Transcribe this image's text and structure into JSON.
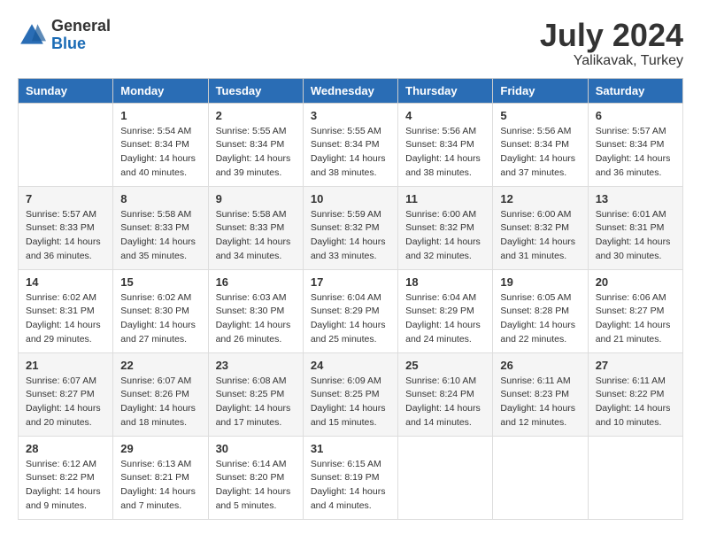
{
  "header": {
    "logo_general": "General",
    "logo_blue": "Blue",
    "title": "July 2024",
    "location": "Yalikavak, Turkey"
  },
  "days_of_week": [
    "Sunday",
    "Monday",
    "Tuesday",
    "Wednesday",
    "Thursday",
    "Friday",
    "Saturday"
  ],
  "weeks": [
    [
      {
        "day": "",
        "sunrise": "",
        "sunset": "",
        "daylight": ""
      },
      {
        "day": "1",
        "sunrise": "Sunrise: 5:54 AM",
        "sunset": "Sunset: 8:34 PM",
        "daylight": "Daylight: 14 hours and 40 minutes."
      },
      {
        "day": "2",
        "sunrise": "Sunrise: 5:55 AM",
        "sunset": "Sunset: 8:34 PM",
        "daylight": "Daylight: 14 hours and 39 minutes."
      },
      {
        "day": "3",
        "sunrise": "Sunrise: 5:55 AM",
        "sunset": "Sunset: 8:34 PM",
        "daylight": "Daylight: 14 hours and 38 minutes."
      },
      {
        "day": "4",
        "sunrise": "Sunrise: 5:56 AM",
        "sunset": "Sunset: 8:34 PM",
        "daylight": "Daylight: 14 hours and 38 minutes."
      },
      {
        "day": "5",
        "sunrise": "Sunrise: 5:56 AM",
        "sunset": "Sunset: 8:34 PM",
        "daylight": "Daylight: 14 hours and 37 minutes."
      },
      {
        "day": "6",
        "sunrise": "Sunrise: 5:57 AM",
        "sunset": "Sunset: 8:34 PM",
        "daylight": "Daylight: 14 hours and 36 minutes."
      }
    ],
    [
      {
        "day": "7",
        "sunrise": "Sunrise: 5:57 AM",
        "sunset": "Sunset: 8:33 PM",
        "daylight": "Daylight: 14 hours and 36 minutes."
      },
      {
        "day": "8",
        "sunrise": "Sunrise: 5:58 AM",
        "sunset": "Sunset: 8:33 PM",
        "daylight": "Daylight: 14 hours and 35 minutes."
      },
      {
        "day": "9",
        "sunrise": "Sunrise: 5:58 AM",
        "sunset": "Sunset: 8:33 PM",
        "daylight": "Daylight: 14 hours and 34 minutes."
      },
      {
        "day": "10",
        "sunrise": "Sunrise: 5:59 AM",
        "sunset": "Sunset: 8:32 PM",
        "daylight": "Daylight: 14 hours and 33 minutes."
      },
      {
        "day": "11",
        "sunrise": "Sunrise: 6:00 AM",
        "sunset": "Sunset: 8:32 PM",
        "daylight": "Daylight: 14 hours and 32 minutes."
      },
      {
        "day": "12",
        "sunrise": "Sunrise: 6:00 AM",
        "sunset": "Sunset: 8:32 PM",
        "daylight": "Daylight: 14 hours and 31 minutes."
      },
      {
        "day": "13",
        "sunrise": "Sunrise: 6:01 AM",
        "sunset": "Sunset: 8:31 PM",
        "daylight": "Daylight: 14 hours and 30 minutes."
      }
    ],
    [
      {
        "day": "14",
        "sunrise": "Sunrise: 6:02 AM",
        "sunset": "Sunset: 8:31 PM",
        "daylight": "Daylight: 14 hours and 29 minutes."
      },
      {
        "day": "15",
        "sunrise": "Sunrise: 6:02 AM",
        "sunset": "Sunset: 8:30 PM",
        "daylight": "Daylight: 14 hours and 27 minutes."
      },
      {
        "day": "16",
        "sunrise": "Sunrise: 6:03 AM",
        "sunset": "Sunset: 8:30 PM",
        "daylight": "Daylight: 14 hours and 26 minutes."
      },
      {
        "day": "17",
        "sunrise": "Sunrise: 6:04 AM",
        "sunset": "Sunset: 8:29 PM",
        "daylight": "Daylight: 14 hours and 25 minutes."
      },
      {
        "day": "18",
        "sunrise": "Sunrise: 6:04 AM",
        "sunset": "Sunset: 8:29 PM",
        "daylight": "Daylight: 14 hours and 24 minutes."
      },
      {
        "day": "19",
        "sunrise": "Sunrise: 6:05 AM",
        "sunset": "Sunset: 8:28 PM",
        "daylight": "Daylight: 14 hours and 22 minutes."
      },
      {
        "day": "20",
        "sunrise": "Sunrise: 6:06 AM",
        "sunset": "Sunset: 8:27 PM",
        "daylight": "Daylight: 14 hours and 21 minutes."
      }
    ],
    [
      {
        "day": "21",
        "sunrise": "Sunrise: 6:07 AM",
        "sunset": "Sunset: 8:27 PM",
        "daylight": "Daylight: 14 hours and 20 minutes."
      },
      {
        "day": "22",
        "sunrise": "Sunrise: 6:07 AM",
        "sunset": "Sunset: 8:26 PM",
        "daylight": "Daylight: 14 hours and 18 minutes."
      },
      {
        "day": "23",
        "sunrise": "Sunrise: 6:08 AM",
        "sunset": "Sunset: 8:25 PM",
        "daylight": "Daylight: 14 hours and 17 minutes."
      },
      {
        "day": "24",
        "sunrise": "Sunrise: 6:09 AM",
        "sunset": "Sunset: 8:25 PM",
        "daylight": "Daylight: 14 hours and 15 minutes."
      },
      {
        "day": "25",
        "sunrise": "Sunrise: 6:10 AM",
        "sunset": "Sunset: 8:24 PM",
        "daylight": "Daylight: 14 hours and 14 minutes."
      },
      {
        "day": "26",
        "sunrise": "Sunrise: 6:11 AM",
        "sunset": "Sunset: 8:23 PM",
        "daylight": "Daylight: 14 hours and 12 minutes."
      },
      {
        "day": "27",
        "sunrise": "Sunrise: 6:11 AM",
        "sunset": "Sunset: 8:22 PM",
        "daylight": "Daylight: 14 hours and 10 minutes."
      }
    ],
    [
      {
        "day": "28",
        "sunrise": "Sunrise: 6:12 AM",
        "sunset": "Sunset: 8:22 PM",
        "daylight": "Daylight: 14 hours and 9 minutes."
      },
      {
        "day": "29",
        "sunrise": "Sunrise: 6:13 AM",
        "sunset": "Sunset: 8:21 PM",
        "daylight": "Daylight: 14 hours and 7 minutes."
      },
      {
        "day": "30",
        "sunrise": "Sunrise: 6:14 AM",
        "sunset": "Sunset: 8:20 PM",
        "daylight": "Daylight: 14 hours and 5 minutes."
      },
      {
        "day": "31",
        "sunrise": "Sunrise: 6:15 AM",
        "sunset": "Sunset: 8:19 PM",
        "daylight": "Daylight: 14 hours and 4 minutes."
      },
      {
        "day": "",
        "sunrise": "",
        "sunset": "",
        "daylight": ""
      },
      {
        "day": "",
        "sunrise": "",
        "sunset": "",
        "daylight": ""
      },
      {
        "day": "",
        "sunrise": "",
        "sunset": "",
        "daylight": ""
      }
    ]
  ]
}
